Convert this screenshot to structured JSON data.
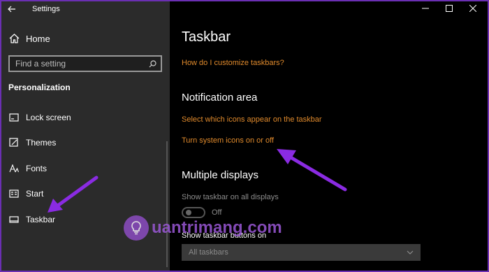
{
  "titlebar": {
    "title": "Settings"
  },
  "sidebar": {
    "home_label": "Home",
    "search_placeholder": "Find a setting",
    "section_title": "Personalization",
    "items": [
      {
        "label": "Lock screen",
        "icon": "lock-screen-icon"
      },
      {
        "label": "Themes",
        "icon": "themes-icon"
      },
      {
        "label": "Fonts",
        "icon": "fonts-icon"
      },
      {
        "label": "Start",
        "icon": "start-icon"
      },
      {
        "label": "Taskbar",
        "icon": "taskbar-icon"
      }
    ]
  },
  "main": {
    "title": "Taskbar",
    "help_link": "How do I customize taskbars?",
    "notification_area": {
      "heading": "Notification area",
      "link1": "Select which icons appear on the taskbar",
      "link2": "Turn system icons on or off"
    },
    "multiple_displays": {
      "heading": "Multiple displays",
      "show_all_label": "Show taskbar on all displays",
      "toggle_state": "Off",
      "show_buttons_label": "Show taskbar buttons on",
      "dropdown_value": "All taskbars"
    }
  },
  "watermark": {
    "text": "uantrimang.com"
  },
  "colors": {
    "accent_link": "#e08a2c",
    "annotation": "#8a2be2",
    "sidebar_bg": "#2b2b2b"
  }
}
